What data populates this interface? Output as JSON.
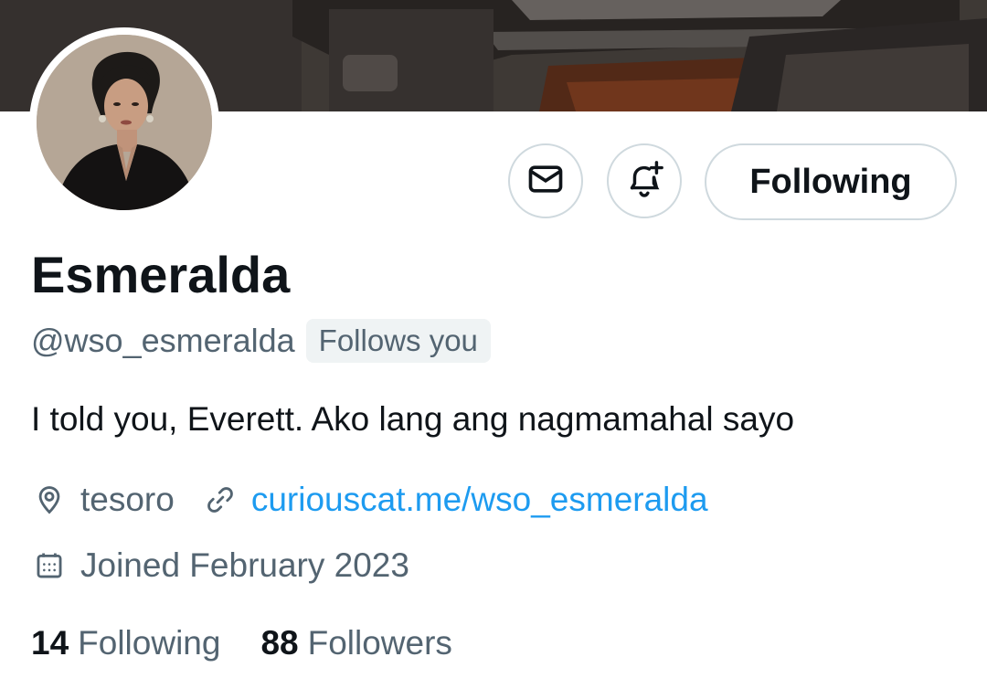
{
  "profile": {
    "display_name": "Esmeralda",
    "handle": "@wso_esmeralda",
    "follows_you_badge": "Follows you",
    "bio": "I told you, Everett. Ako lang ang nagmamahal sayo",
    "location": "tesoro",
    "website": "curiouscat.me/wso_esmeralda",
    "joined": "Joined February 2023"
  },
  "actions": {
    "message_icon": "envelope-icon",
    "notify_icon": "bell-plus-icon",
    "following_label": "Following"
  },
  "stats": {
    "following_count": "14",
    "following_label": "Following",
    "followers_count": "88",
    "followers_label": "Followers"
  },
  "icons": {
    "location": "location-pin-icon",
    "link": "link-icon",
    "calendar": "calendar-icon"
  },
  "colors": {
    "text_primary": "#0f1419",
    "text_secondary": "#536471",
    "link": "#1d9bf0",
    "border": "#cfd9de",
    "badge_bg": "#eff3f4"
  }
}
